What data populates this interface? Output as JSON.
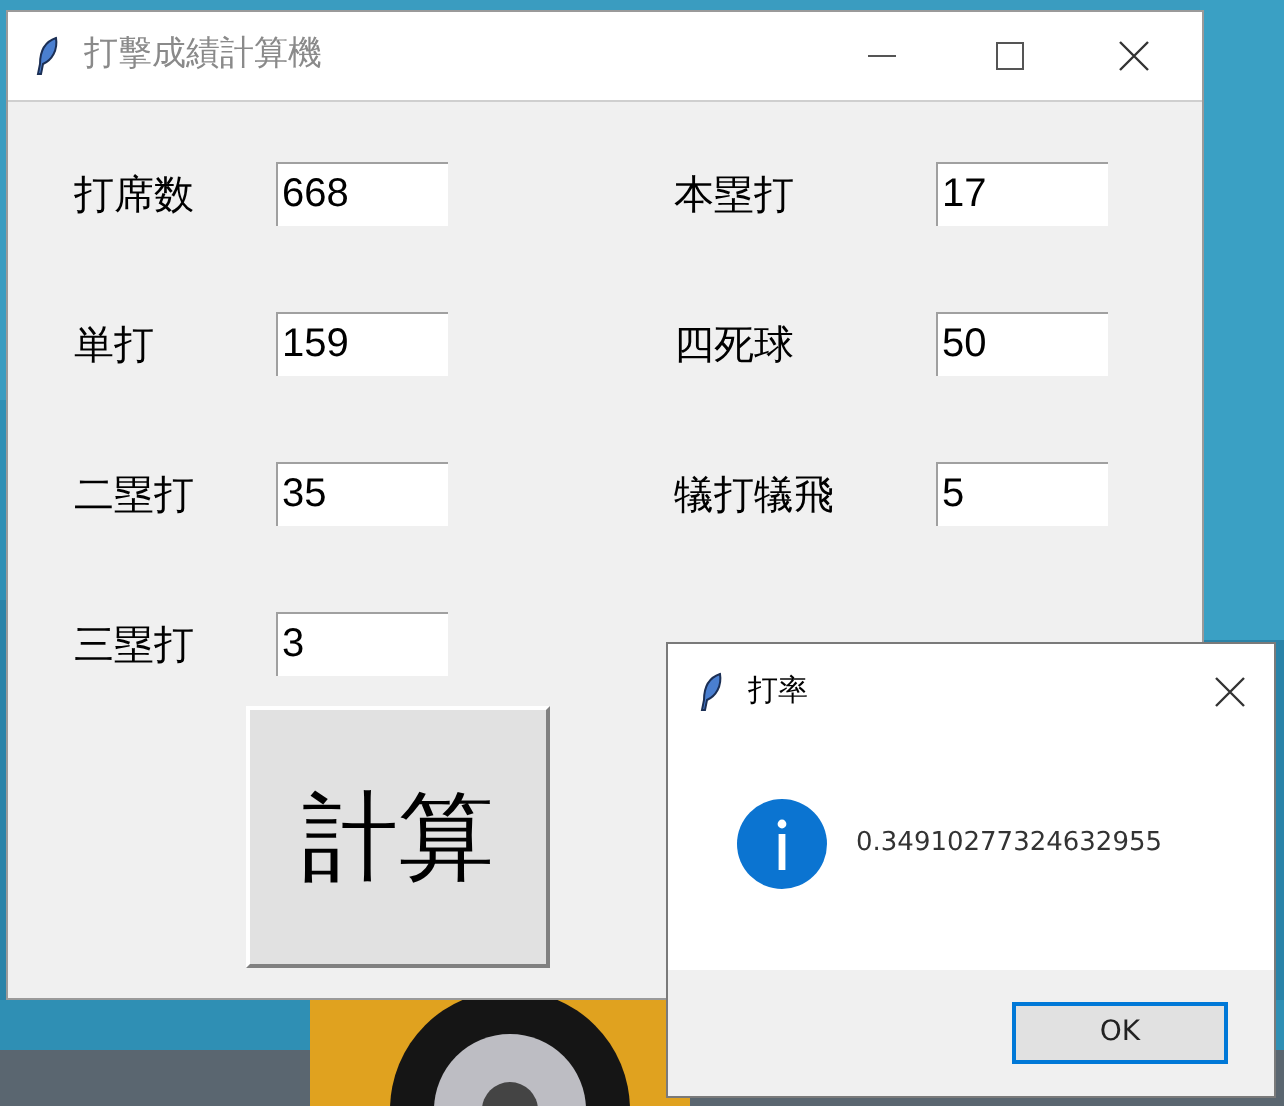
{
  "main_window": {
    "title": "打擊成績計算機",
    "fields": [
      {
        "label": "打席数",
        "value": "668"
      },
      {
        "label": "本塁打",
        "value": "17"
      },
      {
        "label": "単打",
        "value": "159"
      },
      {
        "label": "四死球",
        "value": "50"
      },
      {
        "label": "二塁打",
        "value": "35"
      },
      {
        "label": "犠打犠飛",
        "value": "5"
      },
      {
        "label": "三塁打",
        "value": "3"
      }
    ],
    "button": "計算"
  },
  "dialog": {
    "title": "打率",
    "message": "0.34910277324632955",
    "button": "OK"
  }
}
